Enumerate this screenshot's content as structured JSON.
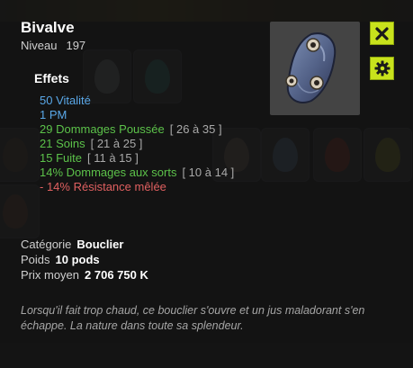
{
  "item": {
    "name": "Bivalve",
    "level_label": "Niveau",
    "level_value": "197"
  },
  "effects": {
    "title": "Effets",
    "lines": [
      {
        "text": "50 Vitalité",
        "range": "",
        "color": "#5aa8e8"
      },
      {
        "text": "1 PM",
        "range": "",
        "color": "#5aa8e8"
      },
      {
        "text": "29 Dommages Poussée",
        "range": "[ 26 à 35 ]",
        "color": "#5cc24a"
      },
      {
        "text": "21 Soins",
        "range": "[ 21 à 25 ]",
        "color": "#5cc24a"
      },
      {
        "text": "15 Fuite",
        "range": "[ 11 à 15 ]",
        "color": "#5cc24a"
      },
      {
        "text": "14% Dommages aux sorts",
        "range": "[ 10 à 14 ]",
        "color": "#5cc24a"
      },
      {
        "text": "- 14% Résistance mêlée",
        "range": "",
        "color": "#e06060"
      }
    ]
  },
  "info": {
    "category_label": "Catégorie",
    "category_value": "Bouclier",
    "weight_label": "Poids",
    "weight_value": "10 pods",
    "price_label": "Prix moyen",
    "price_value": "2 706 750 K"
  },
  "description": "Lorsqu'il fait trop chaud, ce bouclier s'ouvre et un jus maladorant s'en échappe. La nature dans toute sa splendeur.",
  "buttons": {
    "close_icon": "close-icon",
    "settings_icon": "gear-icon"
  },
  "colors": {
    "accent_button": "#c8e21c",
    "bonus_blue": "#5aa8e8",
    "bonus_green": "#5cc24a",
    "malus_red": "#e06060"
  }
}
